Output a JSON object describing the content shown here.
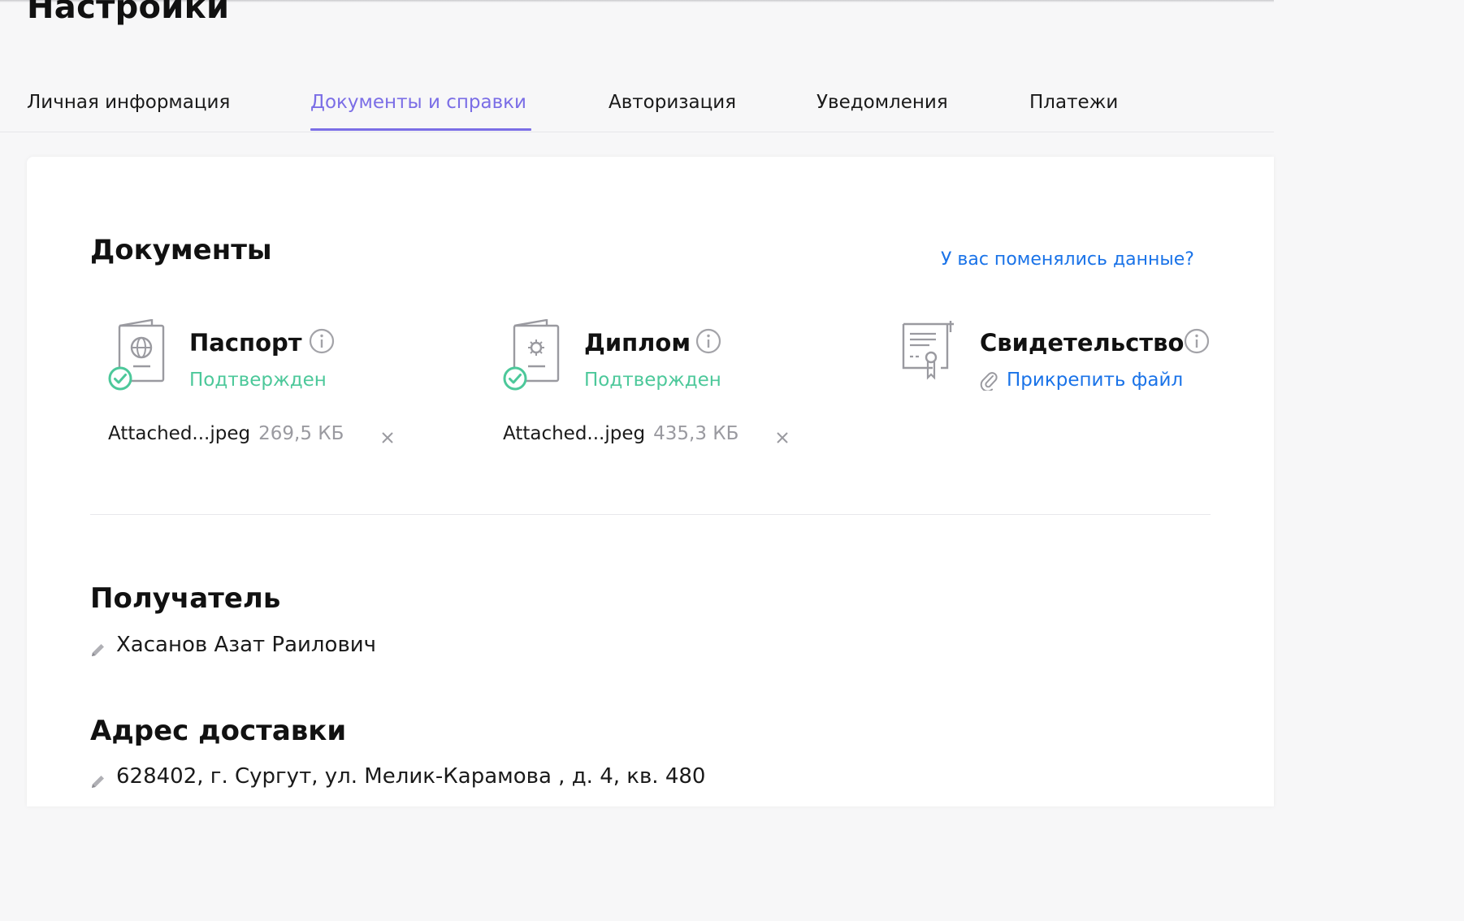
{
  "page": {
    "title": "Настройки"
  },
  "tabs": [
    {
      "label": "Личная информация",
      "active": false
    },
    {
      "label": "Документы и справки",
      "active": true
    },
    {
      "label": "Авторизация",
      "active": false
    },
    {
      "label": "Уведомления",
      "active": false
    },
    {
      "label": "Платежи",
      "active": false
    }
  ],
  "documents": {
    "title": "Документы",
    "change_link": "У вас поменялись данные?",
    "items": [
      {
        "name": "Паспорт",
        "status": "Подтвержден",
        "file_name": "Attached...jpeg",
        "file_size": "269,5 КБ"
      },
      {
        "name": "Диплом",
        "status": "Подтвержден",
        "file_name": "Attached...jpeg",
        "file_size": "435,3 КБ"
      },
      {
        "name": "Свидетельство",
        "attach_label": "Прикрепить файл"
      }
    ]
  },
  "recipient": {
    "title": "Получатель",
    "value": "Хасанов Азат Раилович"
  },
  "delivery": {
    "title": "Адрес доставки",
    "value": "628402, г. Сургут, ул. Мелик-Карамова , д. 4, кв. 480"
  },
  "colors": {
    "accent": "#7b6ee6",
    "link": "#1a73e8",
    "success": "#4cc89a"
  }
}
